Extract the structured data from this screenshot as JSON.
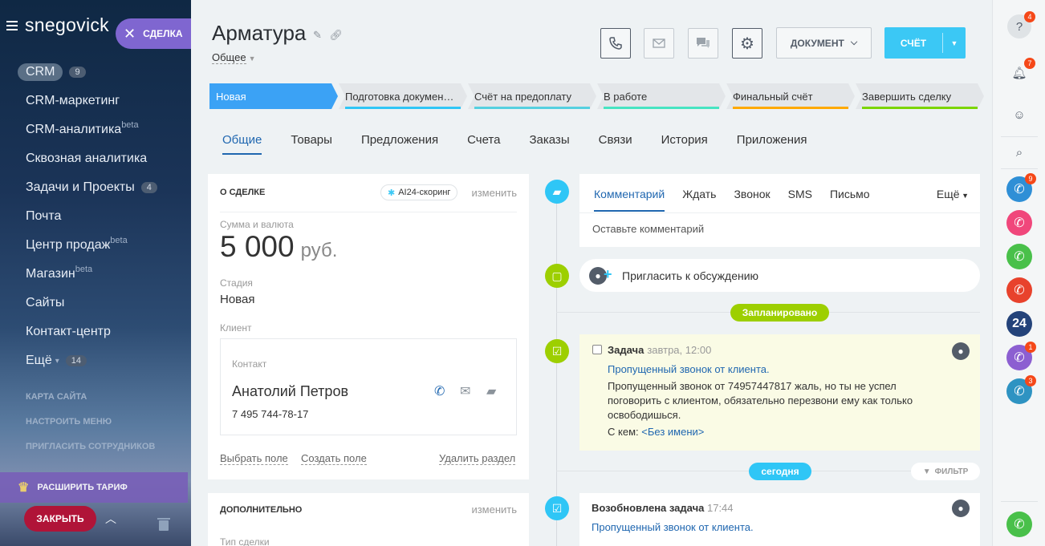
{
  "sidebar": {
    "logo": "snegovick",
    "deal_pill": "СДЕЛКА",
    "menu": [
      {
        "label": "CRM",
        "count": "9",
        "sup": ""
      },
      {
        "label": "CRM-маркетинг",
        "count": "",
        "sup": ""
      },
      {
        "label": "CRM-аналитика",
        "count": "",
        "sup": "beta"
      },
      {
        "label": "Сквозная аналитика",
        "count": "",
        "sup": ""
      },
      {
        "label": "Задачи и Проекты",
        "count": "4",
        "sup": ""
      },
      {
        "label": "Почта",
        "count": "",
        "sup": ""
      },
      {
        "label": "Центр продаж",
        "count": "",
        "sup": "beta"
      },
      {
        "label": "Магазин",
        "count": "",
        "sup": "beta"
      },
      {
        "label": "Сайты",
        "count": "",
        "sup": ""
      },
      {
        "label": "Контакт-центр",
        "count": "",
        "sup": ""
      },
      {
        "label": "Ещё",
        "count": "14",
        "sup": ""
      }
    ],
    "sitemap": "КАРТА САЙТА",
    "configure": "НАСТРОИТЬ МЕНЮ",
    "invite": "ПРИГЛАСИТЬ СОТРУДНИКОВ",
    "tariff": "РАСШИРИТЬ ТАРИФ",
    "close": "ЗАКРЫТЬ"
  },
  "header": {
    "title": "Арматура",
    "category": "Общее",
    "document_btn": "ДОКУМЕНТ",
    "invoice_btn": "СЧЁТ"
  },
  "stages": [
    {
      "label": "Новая",
      "color": "#3ba2f5"
    },
    {
      "label": "Подготовка докумен…",
      "color": "#2fc6f6"
    },
    {
      "label": "Счёт на предоплату",
      "color": "#55d0e0"
    },
    {
      "label": "В работе",
      "color": "#47e4c2"
    },
    {
      "label": "Финальный счёт",
      "color": "#ffa900"
    },
    {
      "label": "Завершить сделку",
      "color": "#7bd500"
    }
  ],
  "tabs": [
    "Общие",
    "Товары",
    "Предложения",
    "Счета",
    "Заказы",
    "Связи",
    "История",
    "Приложения"
  ],
  "about": {
    "heading": "О СДЕЛКЕ",
    "ai": "AI24-скоринг",
    "change": "изменить",
    "amount_label": "Сумма и валюта",
    "amount": "5 000",
    "currency": "руб.",
    "stage_label": "Стадия",
    "stage_value": "Новая",
    "client_label": "Клиент",
    "contact_label": "Контакт",
    "contact_name": "Анатолий Петров",
    "contact_phone": "7 495 744-78-17",
    "select_field": "Выбрать поле",
    "create_field": "Создать поле",
    "delete_section": "Удалить раздел"
  },
  "extra": {
    "heading": "ДОПОЛНИТЕЛЬНО",
    "change": "изменить",
    "type_label": "Тип сделки"
  },
  "activity": {
    "tabs": [
      "Комментарий",
      "Ждать",
      "Звонок",
      "SMS",
      "Письмо"
    ],
    "more": "Ещё",
    "placeholder": "Оставьте комментарий",
    "invite": "Пригласить к обсуждению",
    "planned": "Запланировано",
    "today": "сегодня",
    "filter": "ФИЛЬТР"
  },
  "task": {
    "title": "Задача",
    "time": "завтра, 12:00",
    "link": "Пропущенный звонок от клиента.",
    "body": "Пропущенный звонок от 74957447817 жаль, но ты не успел поговорить с клиентом, обязательно перезвони ему как только освободишься.",
    "with_label": "С кем:",
    "with_value": "<Без имени>"
  },
  "renewed": {
    "title": "Возобновлена задача",
    "time": "17:44",
    "link": "Пропущенный звонок от клиента."
  },
  "right_panel": {
    "help_count": "4",
    "notif_count": "7",
    "calls": [
      {
        "color": "#2f8fd6",
        "count": "9"
      },
      {
        "color": "#f0477b",
        "count": ""
      },
      {
        "color": "#49c04a",
        "count": ""
      },
      {
        "color": "#e8422c",
        "count": ""
      },
      {
        "color": "#24437a",
        "count": "",
        "text": "24"
      },
      {
        "color": "#8c5fd1",
        "count": "1"
      },
      {
        "color": "#2e93c2",
        "count": "3"
      }
    ]
  }
}
